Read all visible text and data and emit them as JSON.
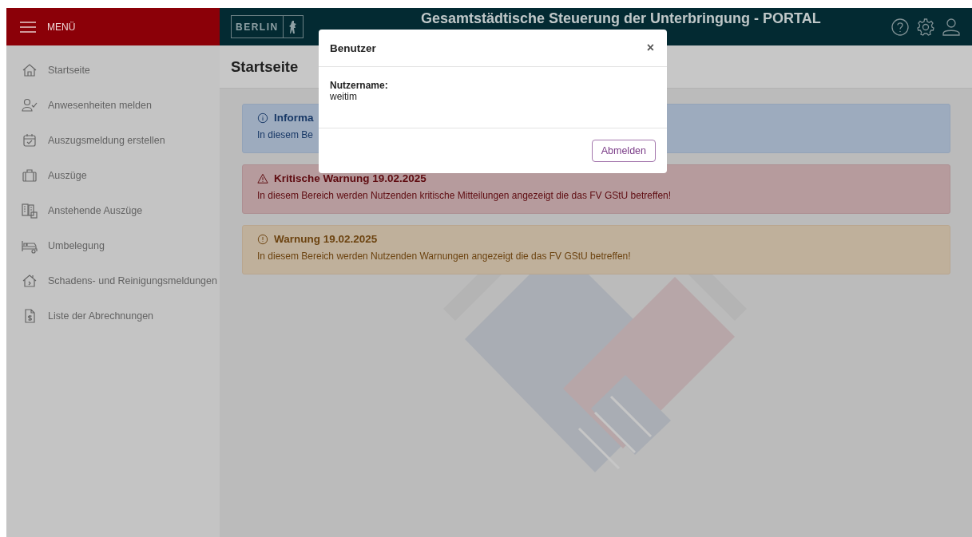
{
  "header": {
    "menu_label": "MENÜ",
    "logo_text": "BERLIN",
    "title": "Gesamtstädtische Steuerung der Unterbringung - PORTAL"
  },
  "sidebar": {
    "items": [
      {
        "label": "Startseite"
      },
      {
        "label": "Anwesenheiten melden"
      },
      {
        "label": "Auszugsmeldung erstellen"
      },
      {
        "label": "Auszüge"
      },
      {
        "label": "Anstehende Auszüge"
      },
      {
        "label": "Umbelegung"
      },
      {
        "label": "Schadens- und Reinigungsmeldungen"
      },
      {
        "label": "Liste der Abrechnungen"
      }
    ]
  },
  "page": {
    "title": "Startseite"
  },
  "alerts": [
    {
      "kind": "info",
      "title": "Informa",
      "text": "In diesem Be"
    },
    {
      "kind": "critical",
      "title": "Kritische Warnung 19.02.2025",
      "text": "In diesem Bereich werden Nutzenden kritische Mitteilungen angezeigt die das FV GStU betreffen!"
    },
    {
      "kind": "warning",
      "title": "Warnung 19.02.2025",
      "text": "In diesem Bereich werden Nutzenden Warnungen angezeigt die das FV GStU betreffen!"
    }
  ],
  "modal": {
    "title": "Benutzer",
    "close": "×",
    "field_label": "Nutzername:",
    "field_value": "weitim",
    "button": "Abmelden"
  }
}
